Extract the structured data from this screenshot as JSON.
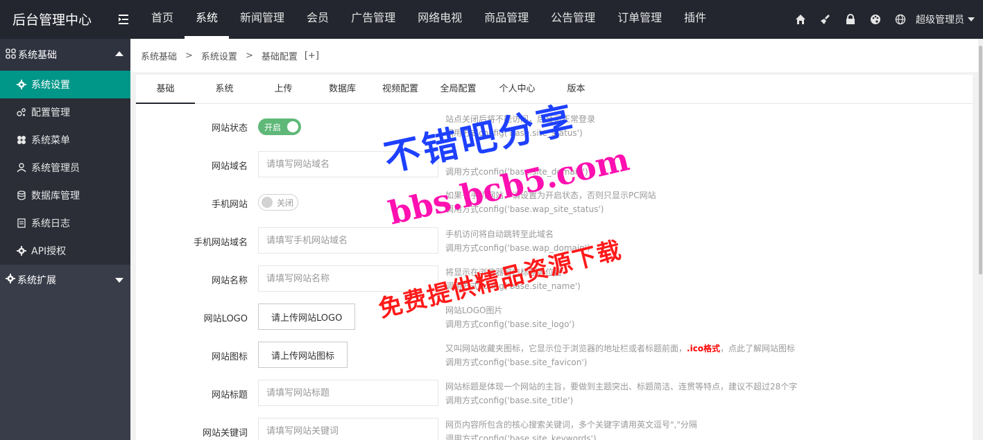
{
  "app": {
    "brand": "后台管理中心"
  },
  "topnav": {
    "items": [
      "首页",
      "系统",
      "新闻管理",
      "会员",
      "广告管理",
      "网络电视",
      "商品管理",
      "公告管理",
      "订单管理",
      "插件"
    ],
    "active": "系统"
  },
  "topright": {
    "icons": [
      "home-icon",
      "broom-icon",
      "lock-icon",
      "palette-icon",
      "globe-icon"
    ],
    "admin_label": "超级管理员"
  },
  "sidebar": {
    "group1": "系统基础",
    "items": [
      {
        "label": "系统设置",
        "icon": "gear-icon"
      },
      {
        "label": "配置管理",
        "icon": "config-icon"
      },
      {
        "label": "系统菜单",
        "icon": "menu-icon"
      },
      {
        "label": "系统管理员",
        "icon": "user-icon"
      },
      {
        "label": "数据库管理",
        "icon": "database-icon"
      },
      {
        "label": "系统日志",
        "icon": "log-icon"
      },
      {
        "label": "API授权",
        "icon": "api-gear-icon"
      }
    ],
    "group2": "系统扩展"
  },
  "breadcrumb": {
    "items": [
      "系统基础",
      "系统设置",
      "基础配置"
    ],
    "separator": ">",
    "plus": "[+]"
  },
  "tabs": [
    "基础",
    "系统",
    "上传",
    "数据库",
    "视频配置",
    "全局配置",
    "个人中心",
    "版本"
  ],
  "form": {
    "site_status": {
      "label": "网站状态",
      "switch": "开启",
      "help1": "站点关闭后将不能访问，后台可正常登录",
      "help2": "调用方式config('base.site_status')"
    },
    "site_domain": {
      "label": "网站域名",
      "placeholder": "请填写网站域名",
      "help2": "调用方式config('base.site_domain')"
    },
    "wap_site": {
      "label": "手机网站",
      "switch": "关闭",
      "help1": "如果有手机网站，请设置为开启状态，否则只显示PC网站",
      "help2": "调用方式config('base.wap_site_status')"
    },
    "wap_domain": {
      "label": "手机网站域名",
      "placeholder": "请填写手机网站域名",
      "help1": "手机访问将自动跳转至此域名",
      "help2": "调用方式config('base.wap_domain')"
    },
    "site_name": {
      "label": "网站名称",
      "placeholder": "请填写网站名称",
      "help1": "将显示在浏览器窗口标题等位置",
      "help2": "调用方式config('base.site_name')"
    },
    "site_logo": {
      "label": "网站LOGO",
      "button": "请上传网站LOGO",
      "help1": "网站LOGO图片",
      "help2": "调用方式config('base.site_logo')"
    },
    "site_favicon": {
      "label": "网站图标",
      "button": "请上传网站图标",
      "help1_a": "又叫网站收藏夹图标，它显示位于浏览器的地址栏或者标题前面，",
      "help1_red": ".ico格式",
      "help1_b": "，点此了解网站图标",
      "help2": "调用方式config('base.site_favicon')"
    },
    "site_title": {
      "label": "网站标题",
      "placeholder": "请填写网站标题",
      "help1": "网站标题是体现一个网站的主旨，要做到主题突出、标题简洁、连贯等特点，建议不超过28个字",
      "help2": "调用方式config('base.site_title')"
    },
    "site_keywords": {
      "label": "网站关键词",
      "placeholder": "请填写网站关键词",
      "help1": "网页内容所包含的核心搜索关键词，多个关键字请用英文逗号\",\"分隔",
      "help2": "调用方式config('base.site_keywords')"
    }
  },
  "watermark": {
    "line1": "不错吧分享",
    "line2": "bbs.bcb5.com",
    "line3": "免费提供精品资源下载"
  },
  "colors": {
    "topbar": "#23262e",
    "sidebar": "#393d49",
    "active": "#009688",
    "switch_on": "#5fb878"
  }
}
